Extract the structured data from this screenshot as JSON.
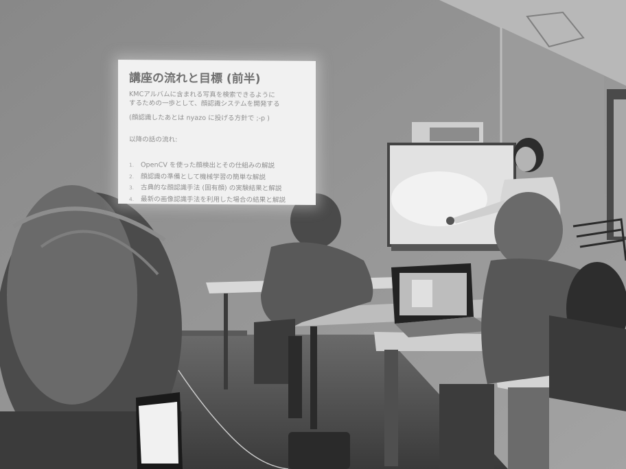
{
  "slide": {
    "title": "講座の流れと目標 (前半)",
    "intro_line1": "KMCアルバムに含まれる写真を検索できるように",
    "intro_line2": "するための一歩として、顔認識システムを開発する",
    "intro_line3": "(顔認識したあとは nyazo に投げる方針で ;-p )",
    "flow_heading": "以降の話の流れ:",
    "items": [
      {
        "num": "1.",
        "text": "OpenCV を使った顔検出とその仕組みの解説"
      },
      {
        "num": "2.",
        "text": "顔認識の準備として機械学習の簡単な解説"
      },
      {
        "num": "3.",
        "text": "古典的な顔認識手法 (固有顔) の実験結果と解説"
      },
      {
        "num": "4.",
        "text": "最新の画像認識手法を利用した場合の結果と解説"
      }
    ]
  }
}
